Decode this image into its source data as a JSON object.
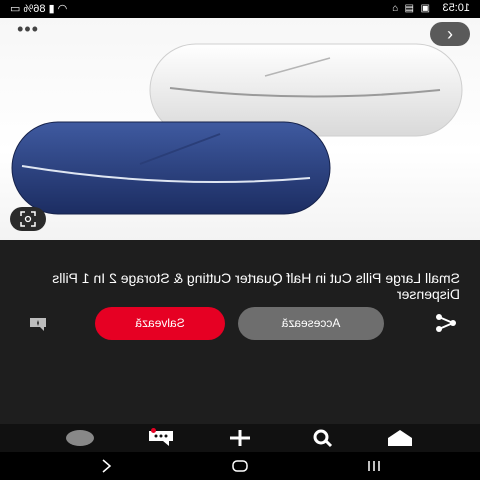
{
  "status_bar": {
    "time": "10:53",
    "battery": "86%"
  },
  "product": {
    "title": "Small Large Pills Cut in Half Quarter Cutting & Storage 2 In 1 Pills Dispenser"
  },
  "actions": {
    "visit_label": "Accesează",
    "save_label": "Salvează"
  },
  "colors": {
    "save": "#e60023",
    "visit": "#6e6e6e",
    "background": "#1e1e1e"
  },
  "icons": {
    "back": "back-arrow-icon",
    "more": "more-options-icon",
    "visual_search": "visual-search-icon",
    "share": "share-icon",
    "comment": "comment-icon",
    "nav": [
      "home-icon",
      "search-icon",
      "create-icon",
      "notifications-icon",
      "profile-icon"
    ]
  }
}
